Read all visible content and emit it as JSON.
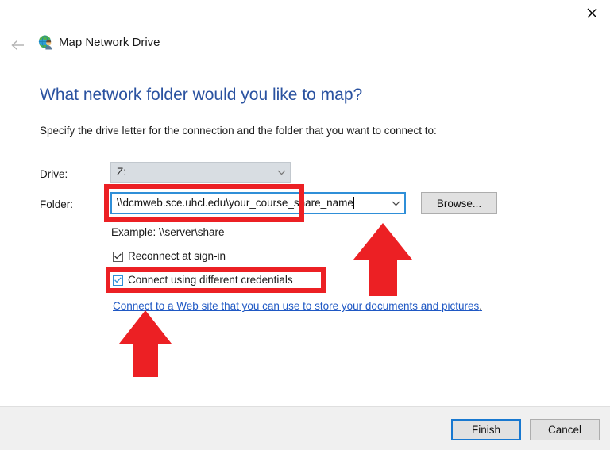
{
  "window": {
    "close_label": "Close",
    "back_label": "Back",
    "wizard_icon": "map-network-drive-icon",
    "wizard_title": "Map Network Drive"
  },
  "content": {
    "heading": "What network folder would you like to map?",
    "subtext": "Specify the drive letter for the connection and the folder that you want to connect to:",
    "drive": {
      "label": "Drive:",
      "value": "Z:",
      "options": [
        "Z:"
      ],
      "disabled": true
    },
    "folder": {
      "label": "Folder:",
      "value": "\\\\dcmweb.sce.uhcl.edu\\your_course_share_name",
      "placeholder": "",
      "focused": true
    },
    "browse_button": "Browse...",
    "example_text": "Example: \\\\server\\share",
    "checkboxes": [
      {
        "label": "Reconnect at sign-in",
        "checked": true,
        "highlighted": false
      },
      {
        "label": "Connect using different credentials",
        "checked": true,
        "highlighted": true
      }
    ],
    "web_link": {
      "text": "Connect to a Web site that you can use to store your documents and pictures",
      "trailing": "."
    }
  },
  "footer": {
    "finish_button": "Finish",
    "cancel_button": "Cancel",
    "default_button": "Finish"
  },
  "annotations": {
    "accent_color": "#ec2024",
    "boxes": [
      {
        "target": "folder-combobox"
      },
      {
        "target": "connect-using-different-credentials-checkbox"
      }
    ],
    "arrows": [
      {
        "direction": "up",
        "target": "folder-combobox"
      },
      {
        "direction": "up",
        "target": "web-site-link"
      }
    ]
  },
  "colors": {
    "heading_blue": "#2a52a0",
    "link_blue": "#1f58c4",
    "focus_blue": "#2f8fd8",
    "default_button_blue": "#1878d0",
    "annotation_red": "#ec2024",
    "footer_gray": "#f0f0f0"
  }
}
